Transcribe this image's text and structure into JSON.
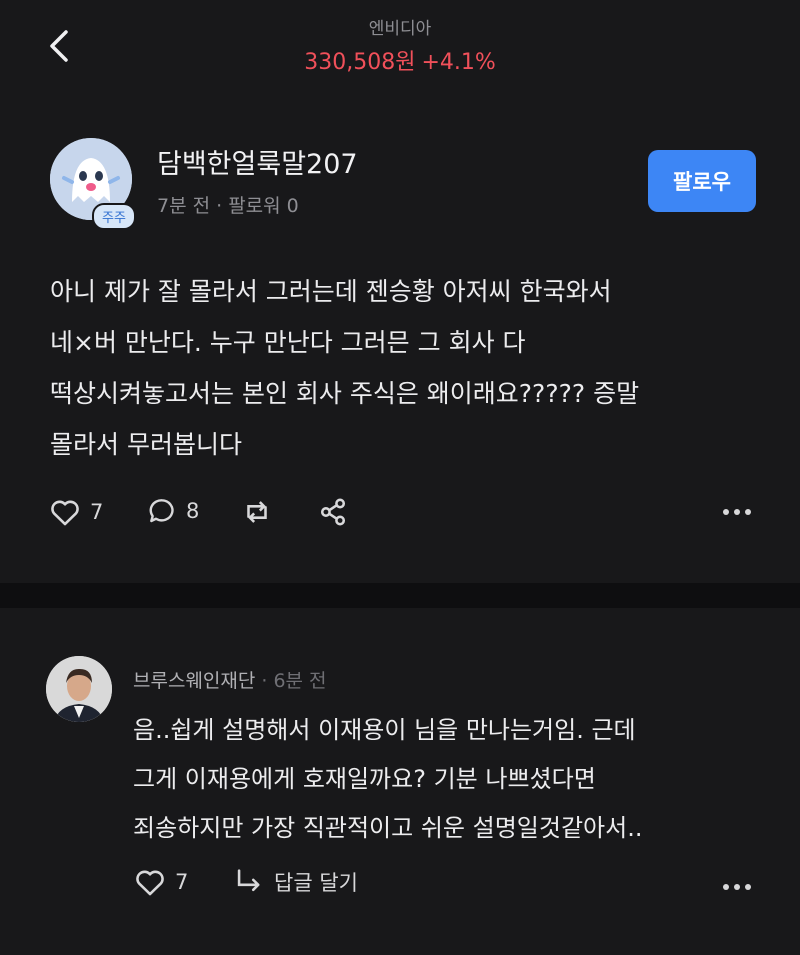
{
  "header": {
    "stock_name": "엔비디아",
    "price": "330,508원",
    "change": "+4.1%"
  },
  "post": {
    "author": "담백한얼룩말207",
    "badge": "주주",
    "meta": "7분 전 · 팔로워 0",
    "follow_label": "팔로우",
    "body_lines": [
      "아니 제가 잘 몰라서 그러는데 젠승황 아저씨 한국와서",
      "네×버 만난다. 누구 만난다 그러믄 그 회사 다",
      "떡상시켜놓고서는 본인 회사 주식은 왜이래요????? 증말",
      "몰라서 무러봅니다"
    ],
    "like_count": "7",
    "comment_count": "8"
  },
  "comment": {
    "author": "브루스웨인재단",
    "time": "· 6분 전",
    "body_lines": [
      "음..쉽게 설명해서 이재용이 님을 만나는거임. 근데",
      "그게 이재용에게 호재일까요? 기분 나쁘셨다면",
      "죄송하지만 가장 직관적이고 쉬운 설명일것같아서.."
    ],
    "like_count": "7",
    "reply_label": "답글 달기"
  }
}
